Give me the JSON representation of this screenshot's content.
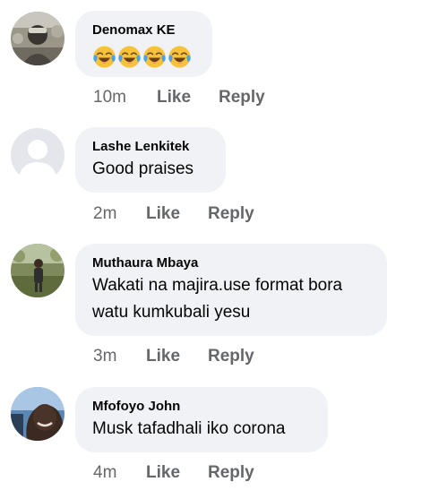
{
  "comments": [
    {
      "author": "Denomax KE",
      "text": "",
      "emoji_icons": [
        "face-with-tears-of-joy-icon",
        "face-with-tears-of-joy-icon",
        "face-with-tears-of-joy-icon",
        "face-with-tears-of-joy-icon"
      ],
      "time": "10m",
      "like_label": "Like",
      "reply_label": "Reply"
    },
    {
      "author": "Lashe Lenkitek",
      "text": "Good praises",
      "time": "2m",
      "like_label": "Like",
      "reply_label": "Reply"
    },
    {
      "author": "Muthaura Mbaya",
      "text_lines": [
        "Wakati na majira.use format bora",
        "watu kumkubali yesu"
      ],
      "time": "3m",
      "like_label": "Like",
      "reply_label": "Reply"
    },
    {
      "author": "Mfofoyo John",
      "text": "Musk tafadhali iko corona",
      "time": "4m",
      "like_label": "Like",
      "reply_label": "Reply"
    }
  ],
  "colors": {
    "bubble_bg": "#f0f2f5",
    "author_text": "#050505",
    "meta_text": "#65676b",
    "emoji_face": "#f7c23a",
    "emoji_tears": "#4aa3e8"
  }
}
